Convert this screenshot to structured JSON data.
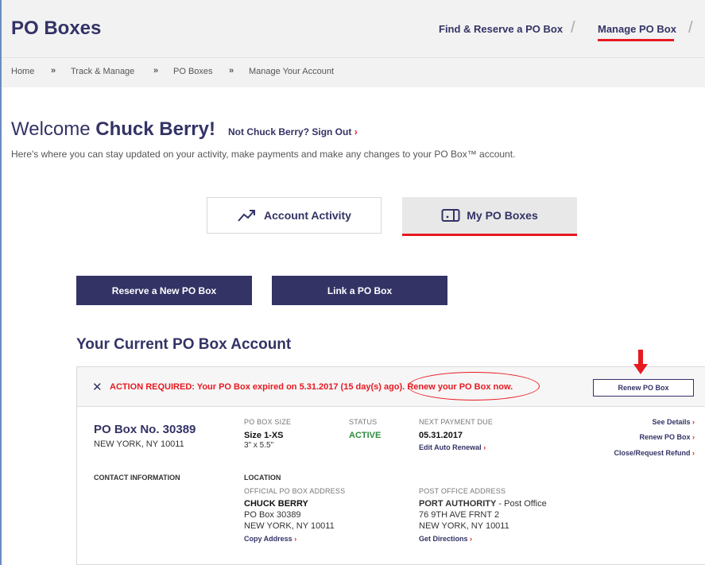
{
  "header": {
    "title": "PO Boxes",
    "nav": [
      {
        "label": "Find & Reserve a PO Box"
      },
      {
        "label": "Manage PO Box"
      }
    ],
    "separator": "/"
  },
  "breadcrumb": {
    "items": [
      "Home",
      "Track & Manage",
      "PO Boxes",
      "Manage Your Account"
    ],
    "separator": "»"
  },
  "welcome": {
    "greeting": "Welcome",
    "name": "Chuck Berry!",
    "signout": "Not Chuck Berry? Sign Out",
    "subtext": "Here's where you can stay updated on your activity, make payments and make any changes to your PO Box™ account."
  },
  "tabs": [
    {
      "label": "Account Activity",
      "icon": "trend-up-icon"
    },
    {
      "label": "My PO Boxes",
      "icon": "po-box-icon",
      "active": true
    }
  ],
  "actions": {
    "reserve": "Reserve a New PO Box",
    "link": "Link a PO Box"
  },
  "section_title": "Your Current PO Box Account",
  "alert": {
    "close": "✕",
    "prefix": "ACTION REQUIRED: Your PO Box expired on 5.31.2017 (15 day(s) ago).",
    "cta": "Renew your PO Box now.",
    "button": "Renew PO Box"
  },
  "box": {
    "number": "PO Box No. 30389",
    "city": "NEW YORK, NY 10011",
    "size_label": "PO BOX SIZE",
    "size_value": "Size 1-XS",
    "size_dims": "3\" x 5.5\"",
    "status_label": "STATUS",
    "status_value": "ACTIVE",
    "payment_label": "NEXT PAYMENT DUE",
    "payment_value": "05.31.2017",
    "auto_renew": "Edit Auto Renewal",
    "links": [
      "See Details",
      "Renew PO Box",
      "Close/Request Refund"
    ],
    "contact_label": "CONTACT INFORMATION",
    "location_label": "LOCATION",
    "official_label": "OFFICIAL PO BOX ADDRESS",
    "official_name": "CHUCK BERRY",
    "official_line1": "PO Box 30389",
    "official_line2": "NEW YORK, NY 10011",
    "copy_address": "Copy Address",
    "po_label": "POST OFFICE ADDRESS",
    "po_name": "PORT AUTHORITY",
    "po_suffix": " - Post Office",
    "po_line1": "76 9TH AVE FRNT 2",
    "po_line2": "NEW YORK, NY 10011",
    "directions": "Get Directions"
  },
  "colors": {
    "navy": "#333366",
    "red": "#e71921",
    "active_green": "#2e8b3b"
  }
}
